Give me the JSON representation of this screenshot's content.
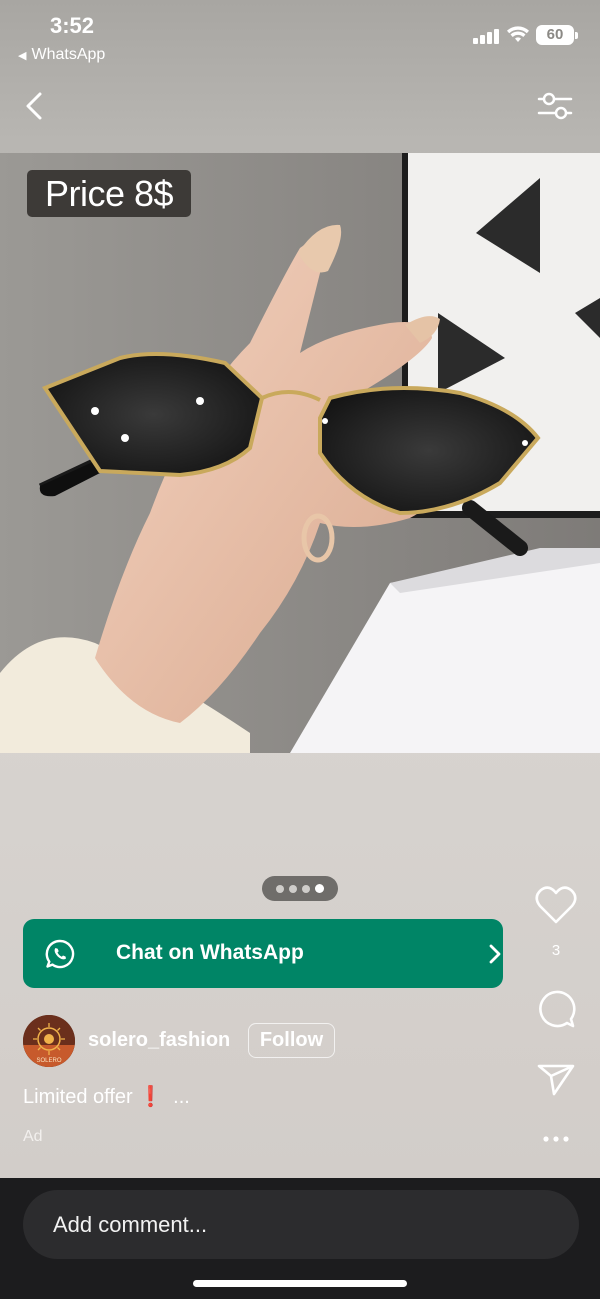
{
  "status_bar": {
    "time": "3:52",
    "back_app": "WhatsApp",
    "battery": "60"
  },
  "icons": {
    "back": "chevron-left-icon",
    "filter": "filter-sliders-icon",
    "like": "heart-icon",
    "comment": "comment-bubble-icon",
    "share": "send-paper-plane-icon",
    "more": "more-dots-icon",
    "whatsapp": "whatsapp-icon",
    "cta_arrow": "chevron-right-icon"
  },
  "post": {
    "price_tag": "Price 8$",
    "carousel": {
      "count": 4,
      "active_index": 3
    },
    "like_count": "3",
    "cta_label": "Chat on WhatsApp",
    "account": {
      "username": "solero_fashion",
      "follow_label": "Follow",
      "avatar_text": "SOLERO"
    },
    "caption": "Limited offer ❗",
    "caption_more": "...",
    "ad_label": "Ad"
  },
  "comment_box": {
    "placeholder": "Add comment..."
  },
  "colors": {
    "cta_green": "#008566",
    "bottom_bar": "#1c1c1e",
    "price_tag_bg": "#3d3a37"
  }
}
